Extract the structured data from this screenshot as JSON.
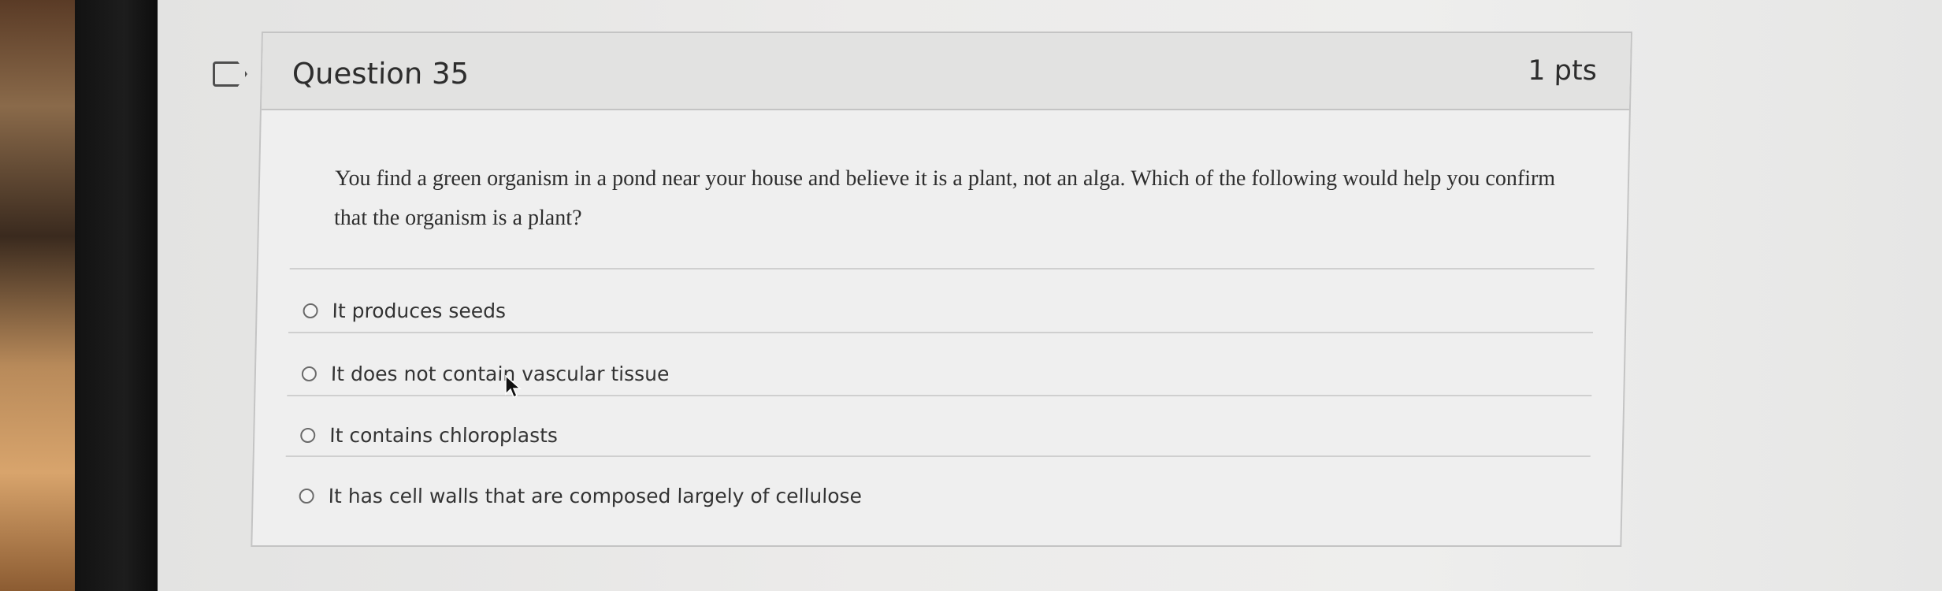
{
  "question": {
    "title": "Question 35",
    "points": "1 pts",
    "stem": "You find a green organism in a pond near your house and believe it is a plant, not an alga. Which of the following would help you confirm that the organism is a plant?",
    "answers": [
      {
        "label": "It produces seeds",
        "selected": false
      },
      {
        "label": "It does not contain vascular tissue",
        "selected": false
      },
      {
        "label": "It contains chloroplasts",
        "selected": false
      },
      {
        "label": "It has cell walls that are composed largely of cellulose",
        "selected": false
      }
    ]
  },
  "icons": {
    "bookmark": "bookmark-flag-icon",
    "cursor": "mouse-pointer-icon"
  },
  "colors": {
    "card_header": "#e2e2e1",
    "card_body": "#efefef",
    "border": "#c4c4c4",
    "text": "#2d2d2d"
  }
}
